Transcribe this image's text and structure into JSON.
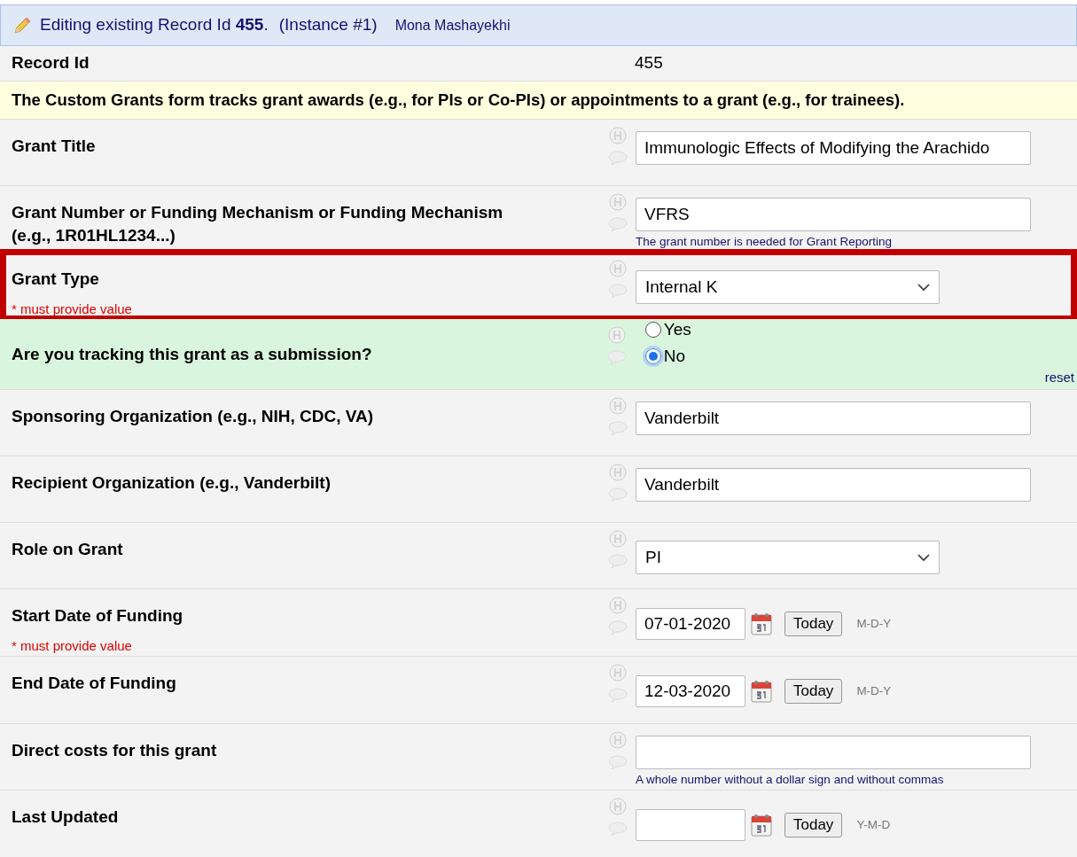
{
  "header": {
    "prefix": "Editing existing Record Id ",
    "record_id": "455",
    "suffix": ".",
    "instance": "(Instance #1)",
    "user": "Mona Mashayekhi"
  },
  "record_row": {
    "label": "Record Id",
    "value": "455"
  },
  "description": "The Custom Grants form tracks grant awards (e.g., for PIs or Co-PIs) or appointments to a grant (e.g., for trainees).",
  "fields": [
    {
      "kind": "text",
      "label": "Grant Title",
      "value": "Immunologic Effects of Modifying the Arachido",
      "flagged": false
    },
    {
      "kind": "text",
      "label": "Grant Number or Funding Mechanism or Funding Mechanism (e.g., 1R01HL1234...)",
      "value": "VFRS",
      "hint": "The grant number is needed for Grant Reporting",
      "flagged": false
    },
    {
      "kind": "select",
      "label": "Grant Type",
      "required_note": "* must provide value",
      "value": "Internal K",
      "flagged": true
    },
    {
      "kind": "radio",
      "label": "Are you tracking this grant as a submission?",
      "options": [
        {
          "label": "Yes",
          "selected": false
        },
        {
          "label": "No",
          "selected": true
        }
      ],
      "reset": "reset",
      "flagged": false
    },
    {
      "kind": "text",
      "label": "Sponsoring Organization (e.g., NIH, CDC, VA)",
      "value": "Vanderbilt",
      "flagged": false
    },
    {
      "kind": "text",
      "label": "Recipient Organization (e.g., Vanderbilt)",
      "value": "Vanderbilt",
      "flagged": false
    },
    {
      "kind": "select",
      "label": "Role on Grant",
      "value": "PI",
      "flagged": false
    },
    {
      "kind": "date",
      "label": "Start Date of Funding",
      "required_note": "* must provide value",
      "value": "07-01-2020",
      "today": "Today",
      "format": "M-D-Y",
      "flagged": false
    },
    {
      "kind": "date",
      "label": "End Date of Funding",
      "value": "12-03-2020",
      "today": "Today",
      "format": "M-D-Y",
      "flagged": false
    },
    {
      "kind": "text",
      "label": "Direct costs for this grant",
      "hint": "A whole number without a dollar sign and without commas",
      "flagged": false
    },
    {
      "kind": "date",
      "label": "Last Updated",
      "today": "Today",
      "format": "Y-M-D",
      "flagged": false
    }
  ]
}
